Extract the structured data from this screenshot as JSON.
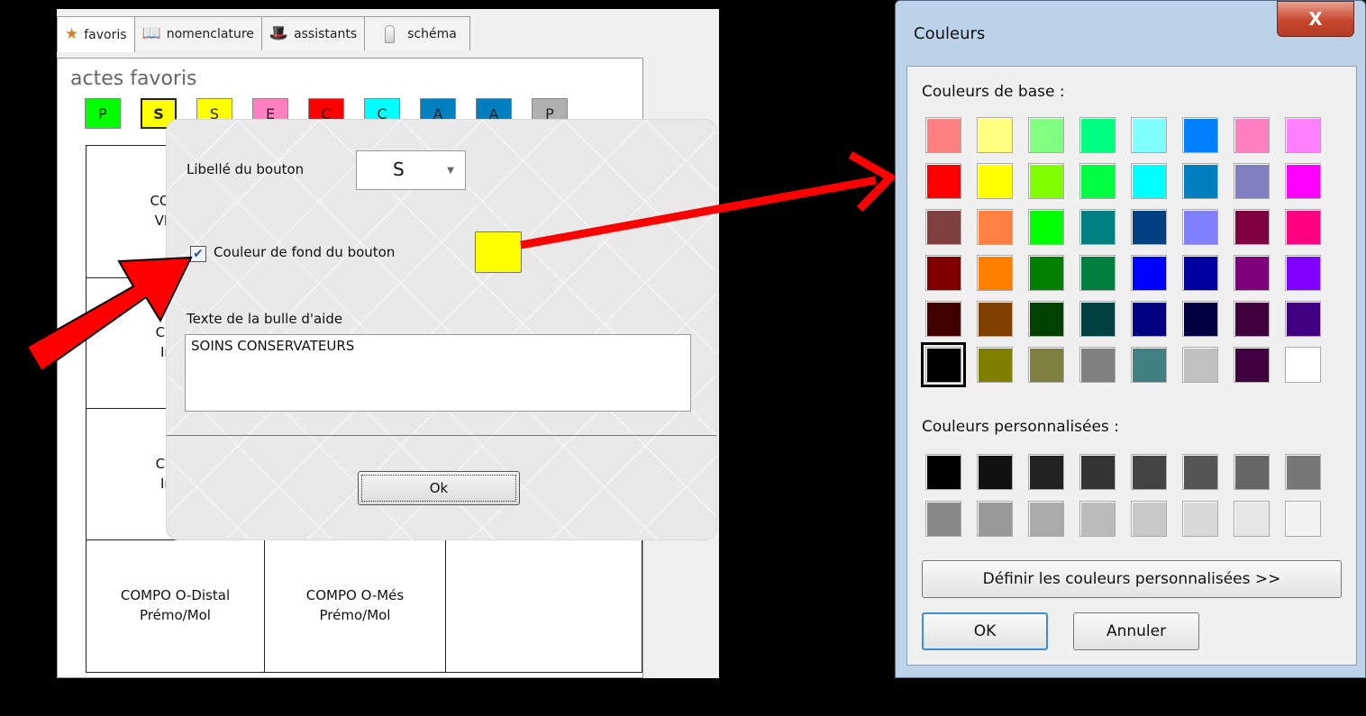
{
  "app": {
    "tabs": [
      {
        "label": "favoris",
        "icon": "star-icon"
      },
      {
        "label": "nomenclature",
        "icon": "book-icon"
      },
      {
        "label": "assistants",
        "icon": "hat-icon"
      },
      {
        "label": "schéma",
        "icon": "tooth-icon"
      }
    ],
    "section_title": "actes favoris",
    "color_buttons": [
      {
        "label": "P",
        "color": "#00ff00"
      },
      {
        "label": "S",
        "color": "#ffff00",
        "selected": true
      },
      {
        "label": "S",
        "color": "#ffff00"
      },
      {
        "label": "E",
        "color": "#ff80c0"
      },
      {
        "label": "C",
        "color": "#ff0000"
      },
      {
        "label": "C",
        "color": "#00ffff"
      },
      {
        "label": "A",
        "color": "#0080c0"
      },
      {
        "label": "A",
        "color": "#0080c0"
      },
      {
        "label": "P",
        "color": "#b0b0b0"
      }
    ],
    "grid_cells": [
      "COMPO\nVMP/L",
      "",
      "",
      "Comp\nInc/(",
      "",
      "",
      "Comp\nInc/(",
      "",
      "",
      "COMPO O-Distal\nPrémo/Mol",
      "COMPO O-Més\nPrémo/Mol",
      ""
    ]
  },
  "popup": {
    "label_button": "Libellé du bouton",
    "button_value": "S",
    "bg_checkbox_label": "Couleur de fond du bouton",
    "bg_checked": true,
    "bg_color": "#ffff00",
    "tooltip_label": "Texte de la bulle d'aide",
    "tooltip_text": "SOINS CONSERVATEURS",
    "ok_label": "Ok"
  },
  "color_dialog": {
    "title": "Couleurs",
    "close_label": "X",
    "base_colors_label": "Couleurs de base :",
    "custom_colors_label": "Couleurs personnalisées :",
    "define_custom_label": "Définir les couleurs personnalisées >>",
    "ok_label": "OK",
    "cancel_label": "Annuler",
    "base_colors": [
      "#ff8080",
      "#ffff80",
      "#80ff80",
      "#00ff80",
      "#80ffff",
      "#0080ff",
      "#ff80c0",
      "#ff80ff",
      "#ff0000",
      "#ffff00",
      "#80ff00",
      "#00ff40",
      "#00ffff",
      "#0080c0",
      "#8080c0",
      "#ff00ff",
      "#804040",
      "#ff8040",
      "#00ff00",
      "#008080",
      "#004080",
      "#8080ff",
      "#800040",
      "#ff0080",
      "#800000",
      "#ff8000",
      "#008000",
      "#008040",
      "#0000ff",
      "#0000a0",
      "#800080",
      "#8000ff",
      "#400000",
      "#804000",
      "#004000",
      "#004040",
      "#000080",
      "#000040",
      "#400040",
      "#400080",
      "#000000",
      "#808000",
      "#808040",
      "#808080",
      "#408080",
      "#c0c0c0",
      "#400040",
      "#ffffff"
    ],
    "selected_base_index": 40,
    "custom_colors": [
      "#000000",
      "#111111",
      "#222222",
      "#333333",
      "#444444",
      "#555555",
      "#666666",
      "#777777",
      "#888888",
      "#999999",
      "#aaaaaa",
      "#bbbbbb",
      "#c8c8c8",
      "#d8d8d8",
      "#e6e6e6",
      "#f2f2f2"
    ]
  },
  "annotations": {
    "arrow_color": "#ff0000"
  }
}
